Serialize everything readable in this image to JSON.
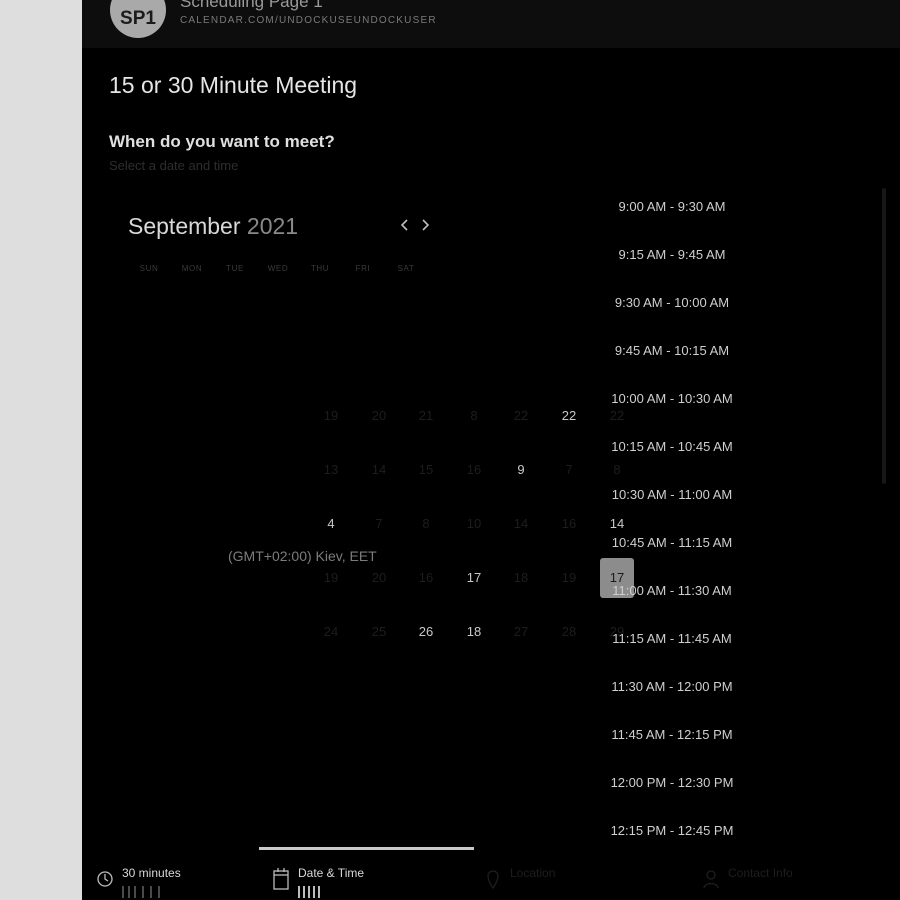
{
  "header": {
    "avatar_initials": "SP1",
    "page_name": "Scheduling Page 1",
    "page_url": "CALENDAR.COM/UNDOCKUSEUNDOCKUSER"
  },
  "meeting": {
    "title": "15 or 30 Minute Meeting",
    "question": "When do you want to meet?",
    "hint": "Select a date and time"
  },
  "calendar": {
    "month": "September",
    "year": "2021",
    "prev_icon": "chevron-left-icon",
    "next_icon": "chevron-right-icon",
    "weekdays": [
      "SUN",
      "MON",
      "TUE",
      "WED",
      "THU",
      "FRI",
      "SAT"
    ],
    "rows": [
      [
        "19",
        "20",
        "21",
        "8",
        "22",
        "22",
        "22"
      ],
      [
        "13",
        "14",
        "15",
        "16",
        "9",
        "7",
        "8"
      ],
      [
        "4",
        "7",
        "8",
        "10",
        "14",
        "16",
        "14"
      ],
      [
        "19",
        "20",
        "16",
        "17",
        "18",
        "19",
        "17"
      ],
      [
        "24",
        "25",
        "26",
        "18",
        "27",
        "28",
        "29"
      ]
    ],
    "available": [
      "22",
      "9",
      "4",
      "14",
      "17",
      "26",
      "18"
    ],
    "selected": "17",
    "accent_color": "#8c8c8c"
  },
  "timezone": "(GMT+02:00) Kiev, EET",
  "time_slots": [
    "9:00 AM - 9:30 AM",
    "9:15 AM - 9:45 AM",
    "9:30 AM - 10:00 AM",
    "9:45 AM - 10:15 AM",
    "10:00 AM - 10:30 AM",
    "10:15 AM - 10:45 AM",
    "10:30 AM - 11:00 AM",
    "10:45 AM - 11:15 AM",
    "11:00 AM - 11:30 AM",
    "11:15 AM - 11:45 AM",
    "11:30 AM - 12:00 PM",
    "11:45 AM - 12:15 PM",
    "12:00 PM - 12:30 PM",
    "12:15 PM - 12:45 PM"
  ],
  "steps": [
    {
      "label": "30 minutes",
      "icon": "clock-icon",
      "state": "active"
    },
    {
      "label": "Date & Time",
      "icon": "calendar-icon",
      "state": "active"
    },
    {
      "label": "Location",
      "icon": "location-icon",
      "state": "dim"
    },
    {
      "label": "Contact Info",
      "icon": "user-icon",
      "state": "dim"
    }
  ]
}
